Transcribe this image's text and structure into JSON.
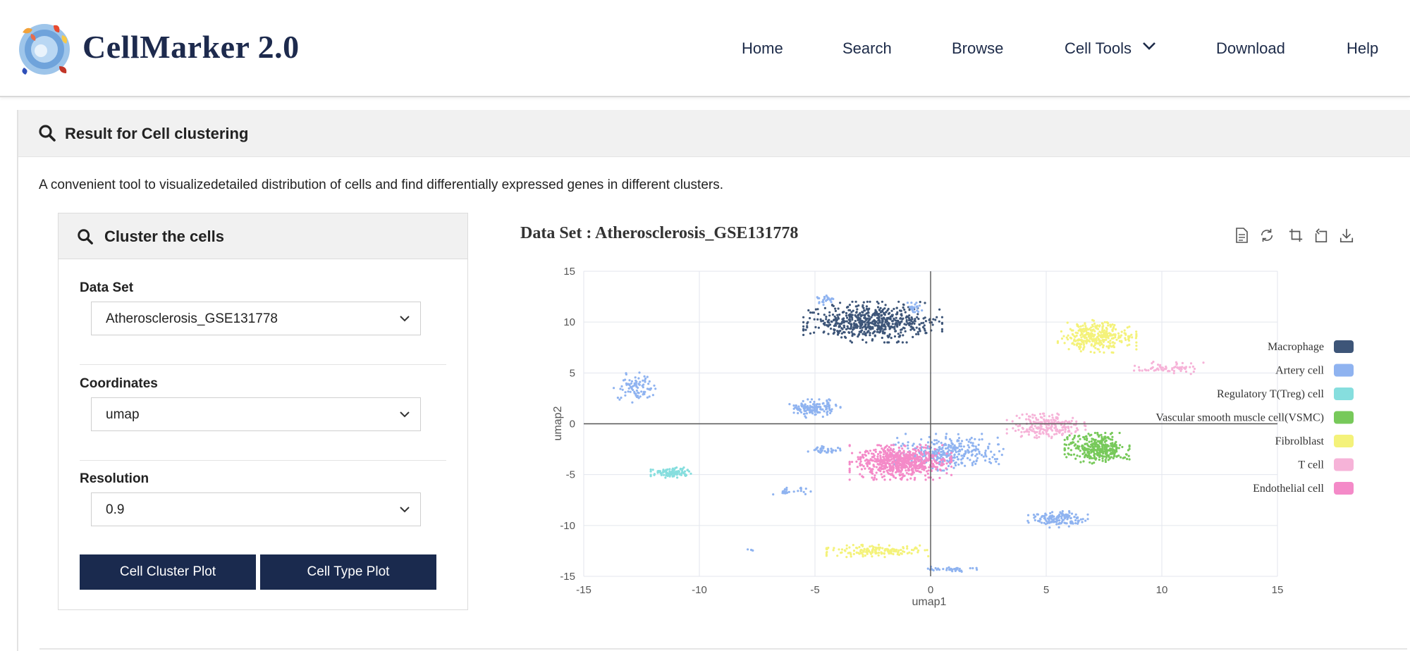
{
  "header": {
    "brand": "CellMarker 2.0",
    "nav": [
      "Home",
      "Search",
      "Browse",
      "Cell Tools",
      "Download",
      "Help"
    ]
  },
  "result_panel": {
    "title": "Result for Cell clustering",
    "description": "A convenient tool to visualizedetailed distribution of cells and find differentially expressed genes in different clusters."
  },
  "cluster_box": {
    "title": "Cluster the cells",
    "dataset_label": "Data Set",
    "dataset_value": "Atherosclerosis_GSE131778",
    "coordinates_label": "Coordinates",
    "coordinates_value": "umap",
    "resolution_label": "Resolution",
    "resolution_value": "0.9",
    "cluster_plot_button": "Cell Cluster Plot",
    "type_plot_button": "Cell Type Plot"
  },
  "colors": {
    "accent": "#1a2a4e",
    "macrophage": "#3d5578",
    "artery": "#8fb3f0",
    "treg": "#86dede",
    "vsmc": "#77c95a",
    "fibroblast": "#f4f27a",
    "tcell": "#f6b3d8",
    "endothelial": "#f48ac8"
  },
  "chart_data": {
    "type": "scatter",
    "title": "Data Set : Atherosclerosis_GSE131778",
    "xlabel": "umap1",
    "ylabel": "umap2",
    "xlim": [
      -15,
      15
    ],
    "ylim": [
      -15,
      15
    ],
    "xticks": [
      -15,
      -10,
      -5,
      0,
      5,
      10,
      15
    ],
    "yticks": [
      15,
      10,
      5,
      0,
      -5,
      -10,
      -15
    ],
    "grid": true,
    "legend_position": "right",
    "series": [
      {
        "name": "Macrophage",
        "color": "#3d5578",
        "clusters": [
          {
            "center": [
              -2.5,
              10.0
            ],
            "spread": [
              3.0,
              2.0
            ],
            "count": 620
          }
        ]
      },
      {
        "name": "Artery cell",
        "color": "#8fb3f0",
        "clusters": [
          {
            "center": [
              -12.8,
              3.6
            ],
            "spread": [
              0.9,
              1.5
            ],
            "count": 90
          },
          {
            "center": [
              -5.0,
              1.5
            ],
            "spread": [
              1.1,
              0.9
            ],
            "count": 140
          },
          {
            "center": [
              -4.5,
              12.3
            ],
            "spread": [
              0.4,
              0.6
            ],
            "count": 25
          },
          {
            "center": [
              -0.7,
              11.4
            ],
            "spread": [
              0.4,
              0.5
            ],
            "count": 25
          },
          {
            "center": [
              0.8,
              -2.8
            ],
            "spread": [
              2.4,
              1.8
            ],
            "count": 320
          },
          {
            "center": [
              -4.5,
              -2.6
            ],
            "spread": [
              0.8,
              0.4
            ],
            "count": 35
          },
          {
            "center": [
              -6.0,
              -6.7
            ],
            "spread": [
              1.0,
              0.4
            ],
            "count": 25
          },
          {
            "center": [
              5.5,
              -9.4
            ],
            "spread": [
              1.3,
              0.8
            ],
            "count": 140
          },
          {
            "center": [
              0.8,
              -14.3
            ],
            "spread": [
              1.2,
              0.25
            ],
            "count": 40
          },
          {
            "center": [
              -7.8,
              -12.4
            ],
            "spread": [
              0.2,
              0.1
            ],
            "count": 4
          }
        ]
      },
      {
        "name": "Regulatory T(Treg) cell",
        "color": "#86dede",
        "clusters": [
          {
            "center": [
              -11.2,
              -4.8
            ],
            "spread": [
              0.9,
              0.5
            ],
            "count": 110
          }
        ]
      },
      {
        "name": "Vascular smooth muscle cell(VSMC)",
        "color": "#77c95a",
        "clusters": [
          {
            "center": [
              7.2,
              -2.4
            ],
            "spread": [
              1.4,
              1.5
            ],
            "count": 330
          }
        ]
      },
      {
        "name": "Fibrolblast",
        "color": "#f4f27a",
        "clusters": [
          {
            "center": [
              7.2,
              8.6
            ],
            "spread": [
              1.7,
              1.6
            ],
            "count": 330
          },
          {
            "center": [
              -2.3,
              -12.5
            ],
            "spread": [
              2.2,
              0.6
            ],
            "count": 160
          }
        ]
      },
      {
        "name": "T cell",
        "color": "#f6b3d8",
        "clusters": [
          {
            "center": [
              5.0,
              -0.2
            ],
            "spread": [
              1.7,
              1.2
            ],
            "count": 220
          },
          {
            "center": [
              10.3,
              5.5
            ],
            "spread": [
              1.5,
              0.6
            ],
            "count": 70
          }
        ]
      },
      {
        "name": "Endothelial cell",
        "color": "#f48ac8",
        "clusters": [
          {
            "center": [
              -1.3,
              -3.8
            ],
            "spread": [
              2.2,
              1.7
            ],
            "count": 680
          }
        ]
      }
    ]
  }
}
